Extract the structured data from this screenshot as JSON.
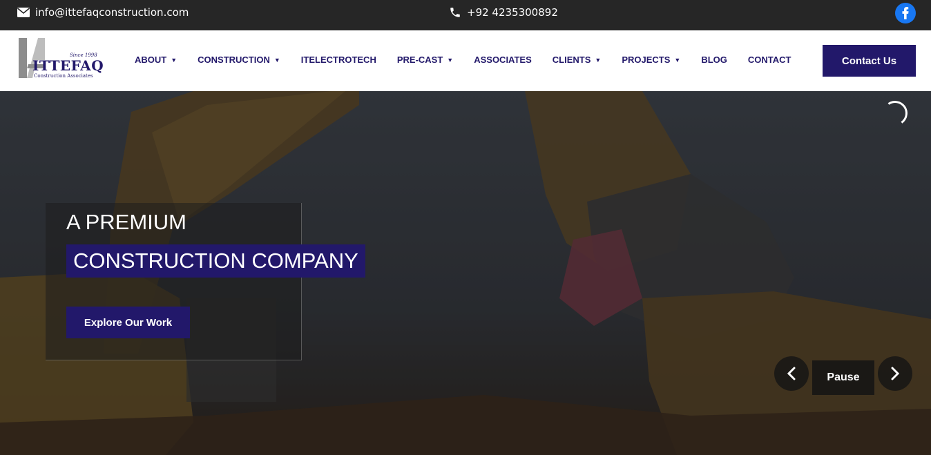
{
  "topbar": {
    "email": "info@ittefaqconstruction.com",
    "phone": "+92 4235300892",
    "social_icon": "facebook-icon"
  },
  "logo": {
    "name": "ITTEFAQ",
    "since": "Since 1998",
    "tagline": "Construction Associates"
  },
  "nav": {
    "items": [
      {
        "label": "ABOUT",
        "has_dropdown": true
      },
      {
        "label": "CONSTRUCTION",
        "has_dropdown": true
      },
      {
        "label": "ITELECTROTECH",
        "has_dropdown": false
      },
      {
        "label": "PRE-CAST",
        "has_dropdown": true
      },
      {
        "label": "ASSOCIATES",
        "has_dropdown": false
      },
      {
        "label": "CLIENTS",
        "has_dropdown": true
      },
      {
        "label": "PROJECTS",
        "has_dropdown": true
      },
      {
        "label": "BLOG",
        "has_dropdown": false
      },
      {
        "label": "CONTACT",
        "has_dropdown": false
      }
    ],
    "dropdown_glyph": "▼",
    "cta_label": "Contact Us"
  },
  "hero": {
    "heading_line1": "A PREMIUM",
    "heading_line2": "CONSTRUCTION COMPANY",
    "button_label": "Explore Our Work",
    "prev_icon": "chevron-left-icon",
    "next_icon": "chevron-right-icon",
    "pause_label": "Pause"
  },
  "colors": {
    "brand": "#22186a",
    "topbar": "#262626",
    "facebook": "#1877f2"
  }
}
